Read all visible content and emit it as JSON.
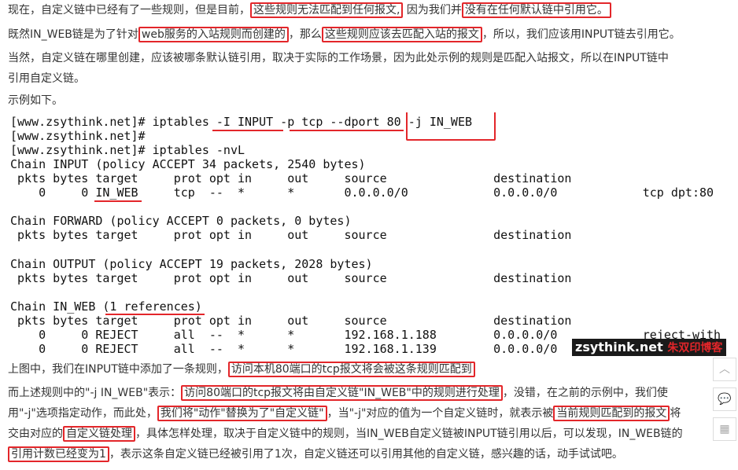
{
  "para1": {
    "a": "现在，自定义链中已经有了一些规则，但是目前，",
    "hl1": "这些规则无法匹配到任何报文,",
    "b": " 因为我们并",
    "hl2": "没有在任何默认链中引用它。"
  },
  "para2": {
    "a": "既然IN_WEB链是为了针对",
    "hl1": "web服务的入站规则而创建的",
    "b": "，那么",
    "hl2": "这些规则应该去匹配入站的报文",
    "c": "，所以，我们应该用INPUT链去引用它。"
  },
  "para3": {
    "line1": "当然，自定义链在哪里创建，应该被哪条默认链引用，取决于实际的工作场景，因为此处示例的规则是匹配入站报文，所以在INPUT链中",
    "line2": "引用自定义链。"
  },
  "para4": "示例如下。",
  "terminal": [
    "[www.zsythink.net]# iptables -I INPUT -p tcp --dport 80 -j IN_WEB",
    "[www.zsythink.net]#",
    "[www.zsythink.net]# iptables -nvL",
    "Chain INPUT (policy ACCEPT 34 packets, 2540 bytes)",
    " pkts bytes target     prot opt in     out     source               destination",
    "    0     0 IN_WEB     tcp  --  *      *       0.0.0.0/0            0.0.0.0/0            tcp dpt:80",
    "",
    "Chain FORWARD (policy ACCEPT 0 packets, 0 bytes)",
    " pkts bytes target     prot opt in     out     source               destination",
    "",
    "Chain OUTPUT (policy ACCEPT 19 packets, 2028 bytes)",
    " pkts bytes target     prot opt in     out     source               destination",
    "",
    "Chain IN_WEB (1 references)",
    " pkts bytes target     prot opt in     out     source               destination",
    "    0     0 REJECT     all  --  *      *       192.168.1.188        0.0.0.0/0            reject-with",
    "    0     0 REJECT     all  --  *      *       192.168.1.139        0.0.0.0/0"
  ],
  "watermark": {
    "main": "zsythink.net",
    "sub": "朱双印博客"
  },
  "para5": {
    "a": "上图中，我们在INPUT链中添加了一条规则，",
    "hl1": "访问本机80端口的tcp报文将会被这条规则匹配到"
  },
  "para6": {
    "line1_a": "而上述规则中的\"-j IN_WEB\"表示：",
    "line1_hl": "访问80端口的tcp报文将由自定义链\"IN_WEB\"中的规则进行处理",
    "line1_b": "，没错，在之前的示例中，我们使",
    "line2_a": "用\"-j\"选项指定动作，而此处，",
    "line2_hl": "我们将\"动作\"替换为了\"自定义链\"",
    "line2_b": "，当\"-j\"对应的值为一个自定义链时，就表示被",
    "line2_hl2": "当前规则匹配到的报文",
    "line2_c": "将",
    "line3_a": "交由对应的",
    "line3_hl": "自定义链处理",
    "line3_b": "，具体怎样处理，取决于自定义链中的规则，当IN_WEB自定义链被INPUT链引用以后，可以发现，IN_WEB链的",
    "line4_hl": "引用计数已经变为1",
    "line4_b": "，表示这条自定义链已经被引用了1次，自定义链还可以引用其他的自定义链，感兴趣的话，动手试试吧。"
  },
  "side": {
    "top": "︿",
    "comment": "💬",
    "qr": "▦"
  }
}
